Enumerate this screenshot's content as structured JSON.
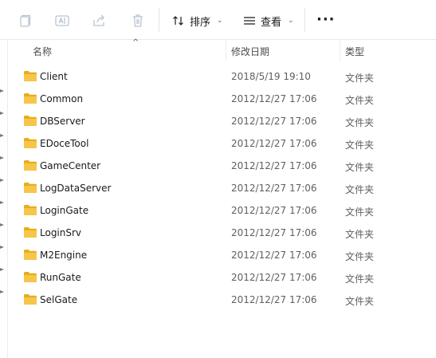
{
  "toolbar": {
    "copy_icon": "copy-icon",
    "rename_icon": "rename-icon",
    "share_icon": "share-icon",
    "delete_icon": "delete-icon",
    "sort_label": "排序",
    "view_label": "查看",
    "more_label": "···"
  },
  "columns": {
    "name": "名称",
    "date": "修改日期",
    "type": "类型"
  },
  "files": [
    {
      "name": "Client",
      "date": "2018/5/19 19:10",
      "type": "文件夹"
    },
    {
      "name": "Common",
      "date": "2012/12/27 17:06",
      "type": "文件夹"
    },
    {
      "name": "DBServer",
      "date": "2012/12/27 17:06",
      "type": "文件夹"
    },
    {
      "name": "EDoceTool",
      "date": "2012/12/27 17:06",
      "type": "文件夹"
    },
    {
      "name": "GameCenter",
      "date": "2012/12/27 17:06",
      "type": "文件夹"
    },
    {
      "name": "LogDataServer",
      "date": "2012/12/27 17:06",
      "type": "文件夹"
    },
    {
      "name": "LoginGate",
      "date": "2012/12/27 17:06",
      "type": "文件夹"
    },
    {
      "name": "LoginSrv",
      "date": "2012/12/27 17:06",
      "type": "文件夹"
    },
    {
      "name": "M2Engine",
      "date": "2012/12/27 17:06",
      "type": "文件夹"
    },
    {
      "name": "RunGate",
      "date": "2012/12/27 17:06",
      "type": "文件夹"
    },
    {
      "name": "SelGate",
      "date": "2012/12/27 17:06",
      "type": "文件夹"
    }
  ],
  "colors": {
    "folder": "#f6c649",
    "folder_dark": "#e8ad1c",
    "disabled_icon": "#b9c4cf",
    "text": "#1a1a1a",
    "muted_text": "#5f5f5f"
  }
}
